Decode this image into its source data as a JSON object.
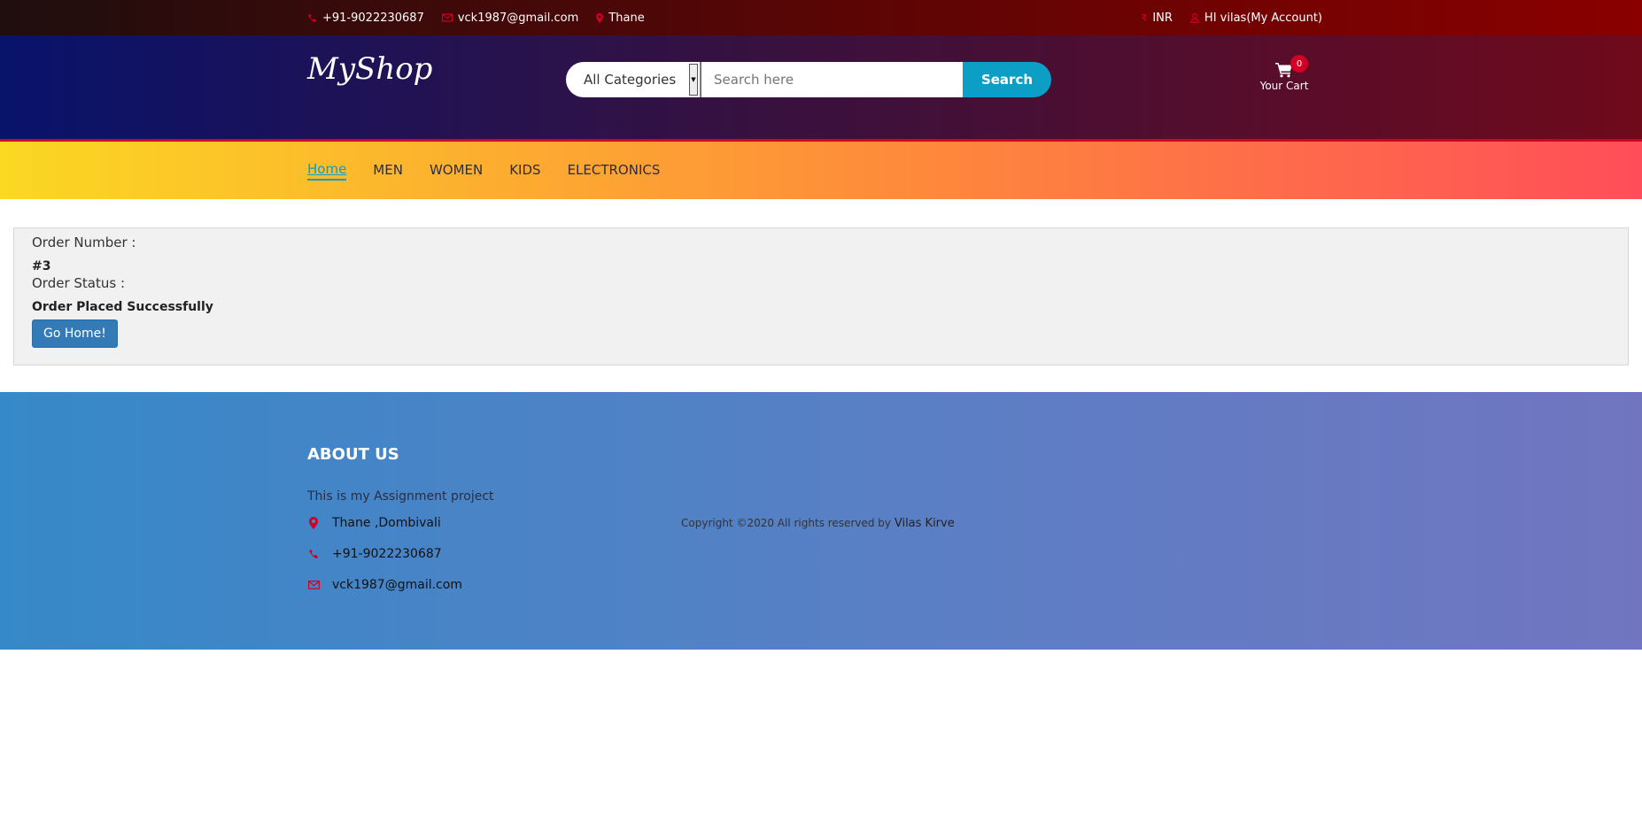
{
  "top_bar": {
    "phone": "+91-9022230687",
    "email": "vck1987@gmail.com",
    "location": "Thane",
    "currency": "INR",
    "account": "HI vilas(My Account)"
  },
  "header": {
    "logo": "MyShop",
    "category_selected": "All Categories",
    "search_placeholder": "Search here",
    "search_button": "Search",
    "cart_count": "0",
    "cart_label": "Your Cart"
  },
  "nav": {
    "items": [
      "Home",
      "MEN",
      "WOMEN",
      "KIDS",
      "ELECTRONICS"
    ],
    "active": "Home"
  },
  "order": {
    "number_label": "Order Number :",
    "number_value": "#3",
    "status_label": "Order Status :",
    "status_value": "Order Placed Successfully",
    "button": "Go Home!"
  },
  "footer": {
    "about_title": "ABOUT US",
    "about_desc": "This is my Assignment project",
    "address": "Thane ,Dombivali",
    "phone": "+91-9022230687",
    "email": "vck1987@gmail.com",
    "copyright": "Copyright ©2020 All rights reserved by",
    "author": "Vilas Kirve"
  },
  "colors": {
    "accent_red": "#d10024",
    "accent_blue": "#0c9ec4"
  }
}
